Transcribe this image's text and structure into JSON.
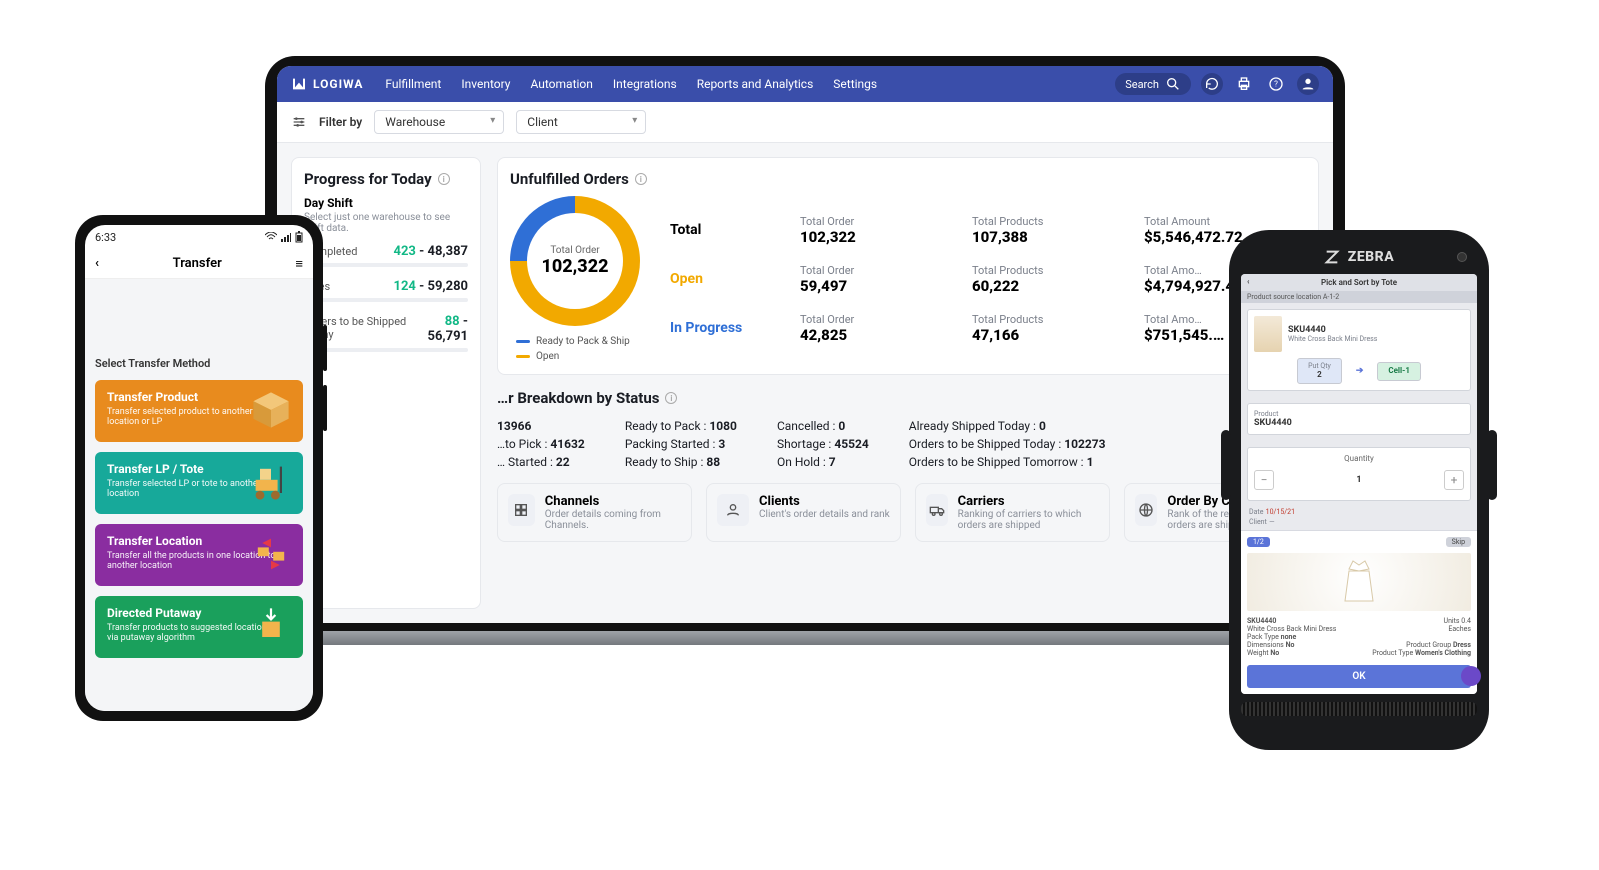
{
  "brand": "LOGIWA",
  "nav": {
    "items": [
      "Fulfillment",
      "Inventory",
      "Automation",
      "Integrations",
      "Reports and Analytics",
      "Settings"
    ],
    "search": "Search"
  },
  "filter": {
    "label": "Filter by",
    "warehouse": "Warehouse",
    "client": "Client"
  },
  "progress": {
    "title": "Progress for Today",
    "shift": "Day Shift",
    "shift_sub": "Select just one warehouse to see shift data.",
    "rows": [
      {
        "label": "Completed",
        "done": "423",
        "total": "48,387"
      },
      {
        "label": "Lines",
        "done": "124",
        "total": "59,280"
      },
      {
        "label": "Orders to be Shipped Today",
        "done": "88",
        "total": "56,791"
      }
    ]
  },
  "unfulfilled": {
    "title": "Unfulfilled Orders",
    "donut_label": "Total Order",
    "donut_value": "102,322",
    "legend": {
      "ready": "Ready to Pack & Ship",
      "open": "Open"
    },
    "rows": {
      "total": {
        "label": "Total",
        "order_lbl": "Total Order",
        "order": "102,322",
        "prod_lbl": "Total Products",
        "prod": "107,388",
        "amt_lbl": "Total Amount",
        "amt": "$5,546,472.72"
      },
      "open": {
        "label": "Open",
        "order_lbl": "Total Order",
        "order": "59,497",
        "prod_lbl": "Total Products",
        "prod": "60,222",
        "amt_lbl": "Total Amo…",
        "amt": "$4,794,927.4…"
      },
      "inprogress": {
        "label": "In Progress",
        "order_lbl": "Total Order",
        "order": "42,825",
        "prod_lbl": "Total Products",
        "prod": "47,166",
        "amt_lbl": "Total Amo…",
        "amt": "$751,545.…"
      }
    }
  },
  "breakdown": {
    "title": "…r Breakdown by Status",
    "c1": [
      {
        "k": "…",
        "v": "13966"
      },
      {
        "k": "…to Pick : ",
        "v": "41632"
      },
      {
        "k": "… Started : ",
        "v": "22"
      }
    ],
    "c2": [
      {
        "k": "Ready to Pack : ",
        "v": "1080"
      },
      {
        "k": "Packing Started : ",
        "v": "3"
      },
      {
        "k": "Ready to Ship : ",
        "v": "88"
      }
    ],
    "c3": [
      {
        "k": "Cancelled : ",
        "v": "0"
      },
      {
        "k": "Shortage : ",
        "v": "45524"
      },
      {
        "k": "On Hold : ",
        "v": "7"
      }
    ],
    "c4": [
      {
        "k": "Already Shipped Today : ",
        "v": "0"
      },
      {
        "k": "Orders to be Shipped Today : ",
        "v": "102273"
      },
      {
        "k": "Orders to be Shipped Tomorrow : ",
        "v": "1"
      }
    ]
  },
  "tiles": [
    {
      "t": "Channels",
      "s": "Order details coming from Channels."
    },
    {
      "t": "Clients",
      "s": "Client's order details and rank"
    },
    {
      "t": "Carriers",
      "s": "Ranking of carriers to which orders are shipped"
    },
    {
      "t": "Order By Country",
      "s": "Rank of the regions where orders are shipped"
    }
  ],
  "phone": {
    "time": "6:33",
    "screen_title": "Transfer",
    "select_label": "Select Transfer Method",
    "options": [
      {
        "t": "Transfer Product",
        "s": "Transfer selected product to another location or LP"
      },
      {
        "t": "Transfer LP / Tote",
        "s": "Transfer selected LP or tote to another location"
      },
      {
        "t": "Transfer Location",
        "s": "Transfer all the products in one location to another location"
      },
      {
        "t": "Directed Putaway",
        "s": "Transfer products to suggested location via putaway algorithm"
      }
    ],
    "colors": [
      "c-orange",
      "c-teal",
      "c-purple",
      "c-green"
    ]
  },
  "zebra": {
    "brand": "ZEBRA",
    "hdr": "Pick and Sort by Tote",
    "loc_strip": "Product source location A-1-2",
    "sku": "SKU4440",
    "sku_sub": "White Cross Back Mini Dress",
    "put_lbl": "Put Qty",
    "put_val": "2",
    "cell": "Cell-1",
    "prod_lbl": "Product",
    "prod_val": "SKU4440",
    "qty_lbl": "Quantity",
    "qty_val": "1",
    "date_lbl": "Date",
    "date_val": "10/15/21",
    "client_lbl": "Client",
    "client_val": "—",
    "badge_left": "1/2",
    "badge_right": "Skip",
    "detail_name": "SKU4440",
    "detail_sub": "White Cross Back Mini Dress",
    "units": "Units 0.4",
    "eaches": "Eaches",
    "pack_lbl": "Pack Type",
    "pack_val": "none",
    "dim_lbl": "Dimensions",
    "dim_val": "No",
    "weight_lbl": "Weight",
    "weight_val": "No",
    "pg_lbl": "Product Group",
    "pg_val": "Dress",
    "pt_lbl": "Product Type",
    "pt_val": "Women's Clothing",
    "ok": "OK"
  },
  "chart_data": {
    "type": "pie",
    "title": "Unfulfilled Orders – Total Order",
    "series": [
      {
        "name": "Open",
        "value": 75,
        "color": "#f2a900"
      },
      {
        "name": "Ready to Pack & Ship",
        "value": 25,
        "color": "#2f6fd6"
      }
    ],
    "center_value": 102322,
    "center_label": "Total Order"
  }
}
